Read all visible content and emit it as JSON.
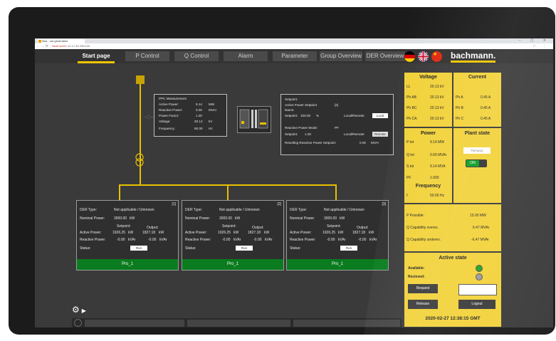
{
  "browser": {
    "tab_title": "ifwa - not generation",
    "url_secure": "Nicht sicher",
    "url": "10.17.45.200/100",
    "window_controls": "– ▢ ✕"
  },
  "nav": {
    "tabs": [
      "Start page",
      "P Control",
      "Q Control",
      "Alarm",
      "Parameter",
      "Group Overview",
      "DER Overview"
    ],
    "active": "Start page",
    "logo": "bachmann."
  },
  "ppc": {
    "title": "PPC Measurement",
    "rows": [
      {
        "label": "Active Power:",
        "value": "9.14",
        "unit": "MW"
      },
      {
        "label": "Reactive Power:",
        "value": "0.00",
        "unit": "MVAr"
      },
      {
        "label": "Power Factor:",
        "value": "1.00",
        "unit": ""
      },
      {
        "label": "Voltage:",
        "value": "20.12",
        "unit": "kV"
      },
      {
        "label": "Frequency:",
        "value": "50.00",
        "unit": "Hz"
      }
    ]
  },
  "setpoint": {
    "title": "Setpoint:",
    "active_label": "Active Power Setpoint",
    "active_index": "[2]",
    "name_label": "Name:",
    "sp_label": "Setpoint:",
    "sp_value": "100.00",
    "sp_unit": "%",
    "local_remote_label": "Local/Remote:",
    "local_btn": "Local",
    "reactive_mode_label": "Reactive Power Mode:",
    "reactive_mode": "PF",
    "reactive_sp_label": "Setpoint:",
    "reactive_sp_value": "1.00",
    "local_remote_label2": "Local/Remote:",
    "remote_btn": "Remote",
    "resulting_label": "Resulting Reactive Power Setpoint:",
    "resulting_value": "0.00",
    "resulting_unit": "MVAr"
  },
  "der": [
    {
      "index": "[1]",
      "type_label": "DER Type:",
      "type": "Not applicable / Unknown",
      "nominal_label": "Nominal Power:",
      "nominal": "3000.00",
      "nominal_unit": "kW",
      "setpoint_hdr": "Setpoint:",
      "output_hdr": "Output:",
      "active_label": "Active Power:",
      "active_sp": "1926.25",
      "active_sp_unit": "kW",
      "active_out": "1827.18",
      "active_out_unit": "kW",
      "reactive_label": "Reactive Power:",
      "reactive_sp": "-0.00",
      "reactive_sp_unit": "kVAr",
      "reactive_out": "-0.00",
      "reactive_out_unit": "kVAr",
      "status_label": "Status:",
      "status": "Run",
      "name": "Pro_1"
    },
    {
      "index": "[2]",
      "type_label": "DER Type:",
      "type": "Not applicable / Unknown",
      "nominal_label": "Nominal Power:",
      "nominal": "3000.00",
      "nominal_unit": "kW",
      "setpoint_hdr": "Setpoint:",
      "output_hdr": "Output:",
      "active_label": "Active Power:",
      "active_sp": "1926.25",
      "active_sp_unit": "kW",
      "active_out": "1827.18",
      "active_out_unit": "kW",
      "reactive_label": "Reactive Power:",
      "reactive_sp": "-0.00",
      "reactive_sp_unit": "kVAr",
      "reactive_out": "-0.00",
      "reactive_out_unit": "kVAr",
      "status_label": "Status:",
      "status": "Run",
      "name": "Pro_1"
    },
    {
      "index": "[3]",
      "type_label": "DER Type:",
      "type": "Not applicable / Unknown",
      "nominal_label": "Nominal Power:",
      "nominal": "3000.00",
      "nominal_unit": "kW",
      "setpoint_hdr": "Setpoint:",
      "output_hdr": "Output:",
      "active_label": "Active Power:",
      "active_sp": "1926.25",
      "active_sp_unit": "kW",
      "active_out": "1827.18",
      "active_out_unit": "kW",
      "reactive_label": "Reactive Power:",
      "reactive_sp": "-0.00",
      "reactive_sp_unit": "kVAr",
      "reactive_out": "-0.00",
      "reactive_out_unit": "kVAr",
      "status_label": "Status:",
      "status": "Run",
      "name": "Pro_1"
    }
  ],
  "voltage": {
    "title": "Voltage",
    "rows": [
      {
        "label": "LL",
        "value": "20.13 kV"
      },
      {
        "label": "Ph AB",
        "value": "20.13 kV"
      },
      {
        "label": "Ph BC",
        "value": "20.13 kV"
      },
      {
        "label": "Ph CA",
        "value": "20.13 kV"
      }
    ]
  },
  "current": {
    "title": "Current",
    "rows": [
      {
        "label": "Ph A",
        "value": "0.45 A"
      },
      {
        "label": "Ph B",
        "value": "0.45 A"
      },
      {
        "label": "Ph C",
        "value": "0.45 A"
      }
    ]
  },
  "power": {
    "title": "Power",
    "rows": [
      {
        "label": "P tot",
        "value": "9.14 MW"
      },
      {
        "label": "Q tot",
        "value": "0.00 MVAr"
      },
      {
        "label": "S tot",
        "value": "9.14 MVA"
      },
      {
        "label": "PF",
        "value": "1.000"
      }
    ]
  },
  "plant_state": {
    "title": "Plant state",
    "mode_btn": "Rampup",
    "toggle": "ON"
  },
  "frequency": {
    "title": "Frequency",
    "label": "f",
    "value": "50.00 Hz"
  },
  "capability": [
    {
      "label": "P Possible:",
      "value": "15.00 MW"
    },
    {
      "label": "Q Capability overex.",
      "value": "6.47 MVAr"
    },
    {
      "label": "Q Capability underex.",
      "value": "-6.47 MVAr"
    }
  ],
  "active_state": {
    "title": "Active state",
    "available_label": "Available:",
    "received_label": "Recieved:",
    "request_btn": "Request",
    "release_btn": "Release",
    "logout_btn": "Logout",
    "timestamp": "2020-02-27 12:38:15 GMT"
  },
  "colors": {
    "accent": "#f0c400",
    "der_footer": "#0a7c1f",
    "panel": "#f2d23a"
  }
}
